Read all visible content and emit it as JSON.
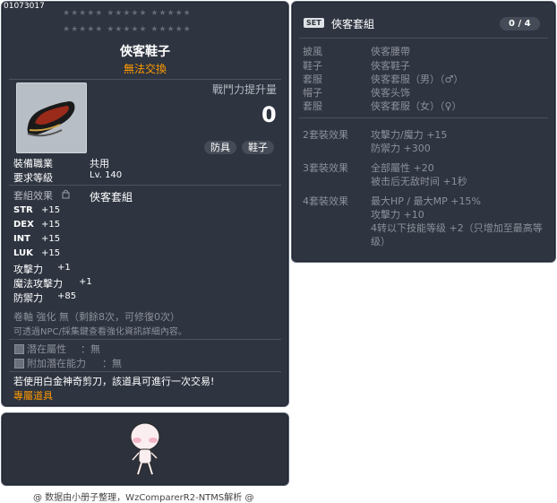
{
  "item_id": "01073017",
  "item": {
    "name": "俠客鞋子",
    "trade": "無法交換",
    "power_label": "戰鬥力提升量",
    "power_value": "0",
    "tags": [
      "防具",
      "鞋子"
    ],
    "job_label": "裝備職業",
    "job_value": "共用",
    "level_label": "要求等級",
    "level_value": "Lv. 140",
    "set_label": "套組效果",
    "set_name": "俠客套組",
    "stats": [
      {
        "name": "STR",
        "value": "+15"
      },
      {
        "name": "DEX",
        "value": "+15"
      },
      {
        "name": "INT",
        "value": "+15"
      },
      {
        "name": "LUK",
        "value": "+15"
      },
      {
        "name": "攻擊力",
        "value": "+1"
      },
      {
        "name": "魔法攻擊力",
        "value": "+1"
      },
      {
        "name": "防禦力",
        "value": "+85"
      }
    ],
    "scroll_line": "卷軸 強化 無（剩餘8次，可修復0次）",
    "npc_line": "可透過NPC/採集鍵查看強化資訊詳細內容。",
    "potential_label": "潛在屬性",
    "potential_value": "：無",
    "addl_label": "附加潛在能力",
    "addl_value": "：無",
    "scissors_line": "若使用白金神奇剪刀，該道具可進行一次交易!",
    "exclusive": "專屬道具"
  },
  "set": {
    "badge": "SET",
    "title": "俠客套組",
    "count": "0 / 4",
    "parts": [
      {
        "slot": "披風",
        "name": "俠客腰帶"
      },
      {
        "slot": "鞋子",
        "name": "俠客鞋子"
      },
      {
        "slot": "套服",
        "name": "俠客套服（男）（♂）"
      },
      {
        "slot": "帽子",
        "name": "俠客头饰"
      },
      {
        "slot": "套服",
        "name": "俠客套服（女）（♀）"
      }
    ],
    "effects": [
      {
        "label": "2套裝效果",
        "lines": [
          "攻擊力/魔力 +15",
          "防禦力 +300"
        ]
      },
      {
        "label": "3套裝效果",
        "lines": [
          "全部屬性 +20",
          "被击后无敌时间 +1秒"
        ]
      },
      {
        "label": "4套裝效果",
        "lines": [
          "最大HP / 最大MP  +15%",
          "攻擊力 +10",
          "4转以下技能等级 +2（只增加至最高等",
          "级）"
        ]
      }
    ]
  },
  "footer": "@ 数据由小册子整理，WzComparerR2-NTMS解析 @",
  "colors": {
    "panel": "#2e3440",
    "green": "#7ad23a",
    "orange": "#ff9a00"
  },
  "icons": [
    "shoe-icon",
    "lock-icon",
    "potential-icon",
    "character-sprite"
  ]
}
